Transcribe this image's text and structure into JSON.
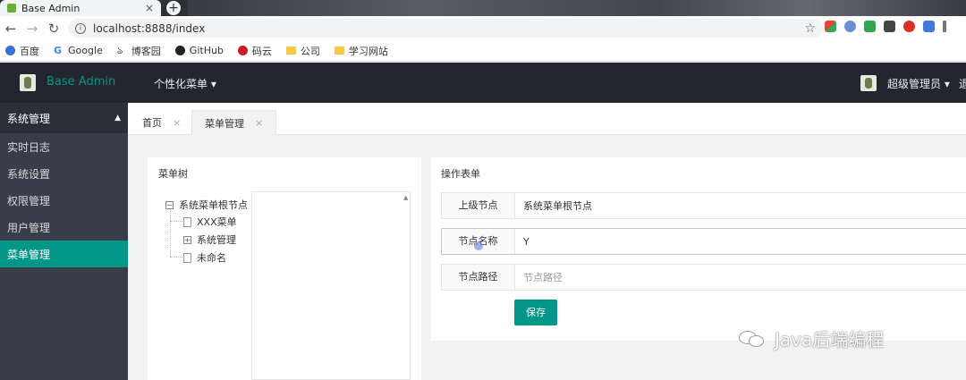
{
  "browser": {
    "tab_title": "Base Admin",
    "tab_close": "×",
    "new_tab": "+",
    "back": "←",
    "forward": "→",
    "reload": "↻",
    "url": "localhost:8888/index",
    "star": "☆"
  },
  "bookmarks": [
    {
      "label": "百度",
      "icon": "baidu-icon",
      "color": "#3b6fd8"
    },
    {
      "label": "Google",
      "icon": "google-icon",
      "color": "#4285f4"
    },
    {
      "label": "博客园",
      "icon": "cnblogs-icon",
      "color": "#333333"
    },
    {
      "label": "GitHub",
      "icon": "github-icon",
      "color": "#222222"
    },
    {
      "label": "码云",
      "icon": "gitee-icon",
      "color": "#c71d23"
    },
    {
      "label": "公司",
      "icon": "folder-icon",
      "color": "#f6c94a"
    },
    {
      "label": "学习网站",
      "icon": "folder-icon",
      "color": "#f6c94a"
    }
  ],
  "header": {
    "app_title": "Base Admin",
    "custom_menu": "个性化菜单 ▾",
    "user_name": "超级管理员 ▾",
    "cut_text": "退"
  },
  "sidebar": {
    "group_label": "系统管理",
    "group_arrow": "▲",
    "items": [
      {
        "label": "实时日志",
        "active": false
      },
      {
        "label": "系统设置",
        "active": false
      },
      {
        "label": "权限管理",
        "active": false
      },
      {
        "label": "用户管理",
        "active": false
      },
      {
        "label": "菜单管理",
        "active": true
      }
    ]
  },
  "tabs": [
    {
      "label": "首页",
      "close": "×",
      "active": false
    },
    {
      "label": "菜单管理",
      "close": "×",
      "active": true
    }
  ],
  "tree_panel": {
    "title": "菜单树",
    "scroll_up": "▲",
    "root": {
      "label": "系统菜单根节点",
      "toggle": "−"
    },
    "children": [
      {
        "label": "XXX菜单",
        "toggle": ""
      },
      {
        "label": "系统管理",
        "toggle": "+"
      },
      {
        "label": "未命名",
        "toggle": ""
      }
    ]
  },
  "form_panel": {
    "title": "操作表单",
    "fields": [
      {
        "label": "上级节点",
        "value": "系统菜单根节点",
        "placeholder": ""
      },
      {
        "label": "节点名称",
        "value": "Y",
        "placeholder": ""
      },
      {
        "label": "节点路径",
        "value": "",
        "placeholder": "节点路径"
      }
    ],
    "save_label": "保存"
  },
  "watermark": "Java后端编程",
  "colors": {
    "accent": "#009688",
    "header_bg": "#23262e",
    "sidebar_bg": "#393d49"
  }
}
